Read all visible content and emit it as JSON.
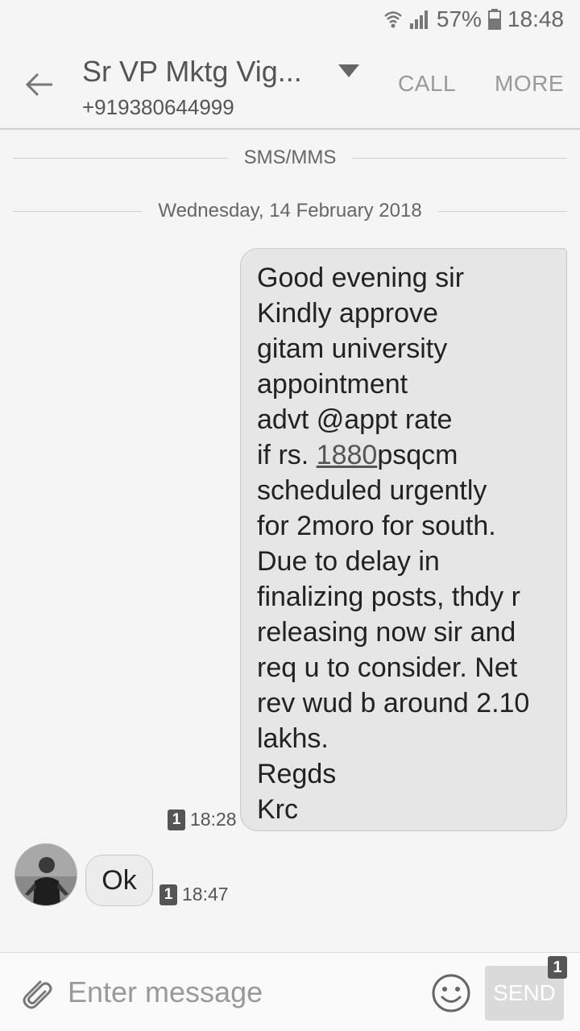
{
  "status_bar": {
    "battery": "57%",
    "time": "18:48",
    "icons": [
      "wifi-icon",
      "signal-icon",
      "battery-icon"
    ]
  },
  "header": {
    "contact_name": "Sr VP Mktg Vig...",
    "contact_number": "+919380644999",
    "call_label": "CALL",
    "more_label": "MORE",
    "icons": [
      "back-arrow-icon",
      "dropdown-triangle-icon"
    ]
  },
  "thread": {
    "channel_label": "SMS/MMS",
    "date_label": "Wednesday, 14 February 2018",
    "messages": [
      {
        "direction": "sent",
        "lines": [
          "Good evening sir",
          "Kindly approve",
          "gitam university",
          "appointment",
          "advt @appt rate",
          "if rs. ",
          "scheduled urgently",
          "for 2moro for south.",
          "Due to delay in",
          "finalizing posts, thdy r",
          "releasing now sir and",
          "req u to consider. Net",
          "rev wud b around 2.10",
          "lakhs.",
          "Regds",
          "Krc"
        ],
        "link_number": "1880",
        "link_suffix": "psqcm",
        "sim": "1",
        "time": "18:28"
      },
      {
        "direction": "received",
        "text": "Ok",
        "sim": "1",
        "time": "18:47"
      }
    ]
  },
  "composer": {
    "placeholder": "Enter message",
    "send_label": "SEND",
    "send_sim": "1",
    "icons": [
      "paperclip-icon",
      "emoji-icon"
    ]
  },
  "colors": {
    "background": "#f5f5f5",
    "bubble": "#e6e6e6",
    "text": "#222222",
    "muted": "#999999"
  }
}
